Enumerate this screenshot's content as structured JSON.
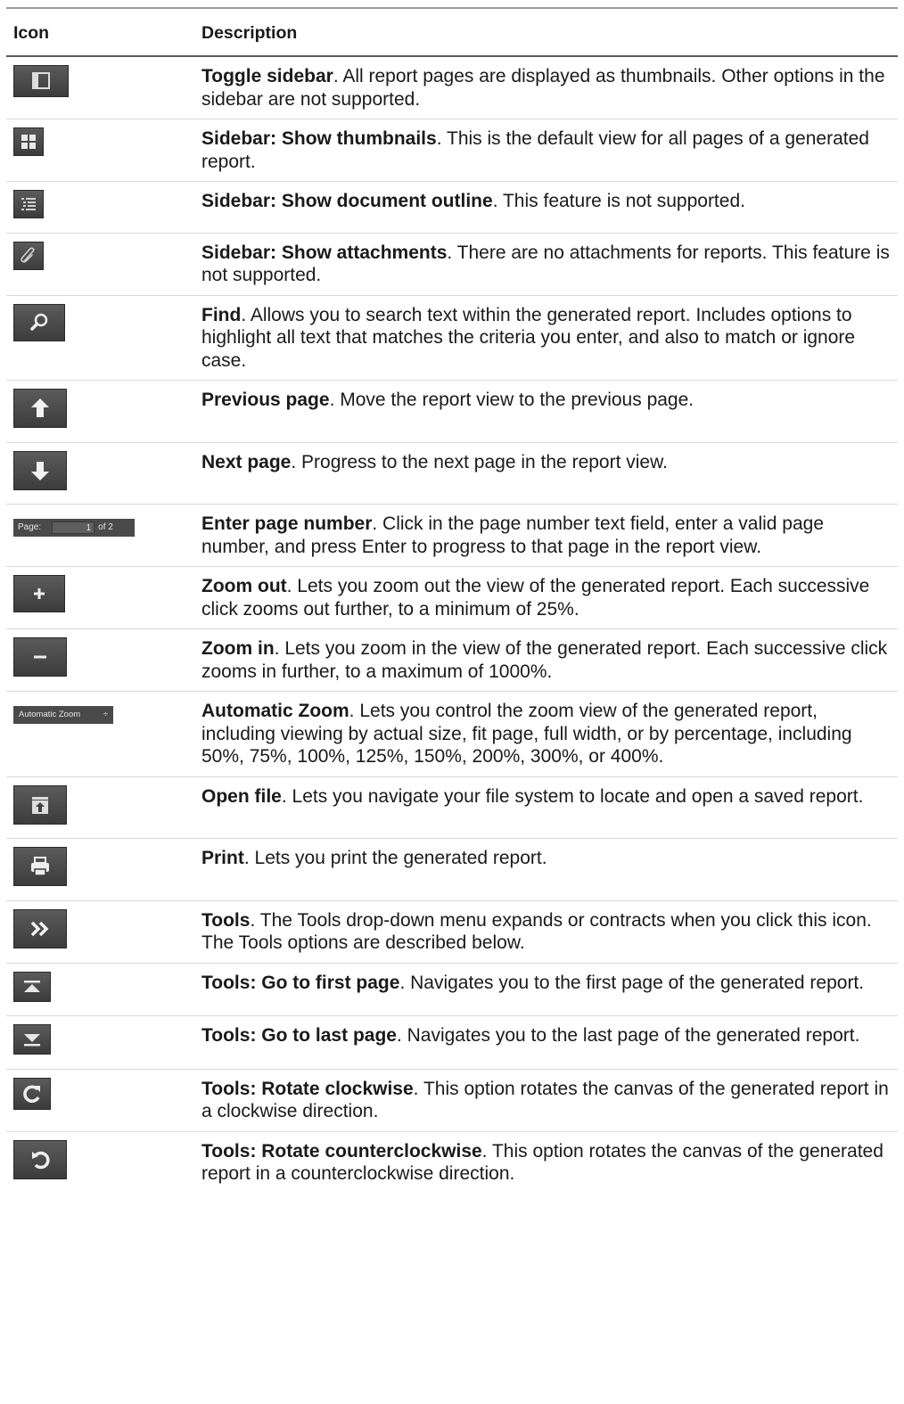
{
  "table": {
    "header_icon": "Icon",
    "header_description": "Description"
  },
  "rows": [
    {
      "icon": "toggle-sidebar-icon",
      "title": "Toggle sidebar",
      "text": ". All report pages are displayed as thumbnails. Other options in the sidebar are not supported."
    },
    {
      "icon": "thumbnails-icon",
      "title": "Sidebar: Show thumbnails",
      "text": ". This is the default view for all pages of a generated report."
    },
    {
      "icon": "document-outline-icon",
      "title": "Sidebar: Show document outline",
      "text": ". This feature is not supported."
    },
    {
      "icon": "paperclip-icon",
      "title": "Sidebar: Show attachments",
      "text": ". There are no attachments for reports. This feature is not supported."
    },
    {
      "icon": "search-icon",
      "title": "Find",
      "text": ". Allows you to search text within the generated report. Includes options to highlight all text that matches the criteria you enter, and also to match or ignore case."
    },
    {
      "icon": "arrow-up-icon",
      "title": "Previous page",
      "text": ". Move the report view to the previous page."
    },
    {
      "icon": "arrow-down-icon",
      "title": "Next page",
      "text": ". Progress to the next page in the report view."
    },
    {
      "icon": "page-number-field",
      "title": "Enter page number",
      "text": ". Click in the page number text field, enter a valid page number, and press Enter to progress to that page in the report view."
    },
    {
      "icon": "plus-icon",
      "title": "Zoom out",
      "text": ". Lets you zoom out the view of the generated report. Each successive click zooms out further, to a minimum of 25%."
    },
    {
      "icon": "minus-icon",
      "title": "Zoom in",
      "text": ". Lets you zoom in the view of the generated report. Each successive click zooms in further, to a maximum of 1000%."
    },
    {
      "icon": "zoom-select",
      "title": "Automatic Zoom",
      "text": ". Lets you control the zoom view of the generated report, including viewing by actual size, fit page, full width, or by percentage, including 50%, 75%, 100%, 125%, 150%, 200%, 300%, or 400%."
    },
    {
      "icon": "open-file-icon",
      "title": "Open file",
      "text": ". Lets you navigate your file system to locate and open a saved report."
    },
    {
      "icon": "print-icon",
      "title": "Print",
      "text": ". Lets you print the generated report."
    },
    {
      "icon": "double-chevron-right-icon",
      "title": "Tools",
      "text": ". The Tools drop-down menu expands or contracts when you click this icon. The Tools options are described below."
    },
    {
      "icon": "first-page-icon",
      "title": "Tools: Go to first page",
      "text": ". Navigates you to the first page of the generated report."
    },
    {
      "icon": "last-page-icon",
      "title": "Tools: Go to last page",
      "text": ". Navigates you to the last page of the generated report."
    },
    {
      "icon": "rotate-clockwise-icon",
      "title": "Tools: Rotate clockwise",
      "text": ". This option rotates the canvas of the generated report in a clockwise direction."
    },
    {
      "icon": "rotate-counterclockwise-icon",
      "title": "Tools: Rotate counterclockwise",
      "text": ". This option rotates the canvas of the generated report in a counterclockwise direction."
    }
  ],
  "page_widget": {
    "label": "Page:",
    "value": "1",
    "of": "of 2"
  },
  "zoom_widget": {
    "label": "Automatic Zoom",
    "arrow": "÷"
  }
}
